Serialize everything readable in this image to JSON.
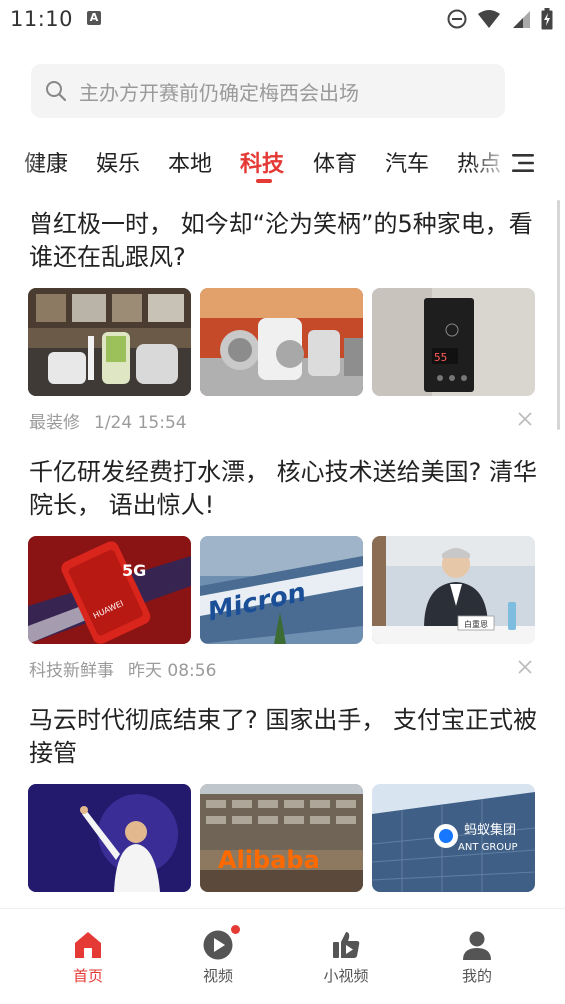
{
  "status_bar": {
    "time": "11:10",
    "notification_letter": "A"
  },
  "search": {
    "placeholder": "主办方开赛前仍确定梅西会出场"
  },
  "tabs": [
    {
      "label": "健康",
      "active": false
    },
    {
      "label": "娱乐",
      "active": false
    },
    {
      "label": "本地",
      "active": false
    },
    {
      "label": "科技",
      "active": true
    },
    {
      "label": "体育",
      "active": false
    },
    {
      "label": "汽车",
      "active": false
    },
    {
      "label": "热点",
      "active": false
    }
  ],
  "articles": [
    {
      "title": "曾红极一时， 如今却“沦为笑柄”的5种家电，看谁还在乱跟风?",
      "source": "最装修",
      "time": "1/24 15:54",
      "image_brand_text": ""
    },
    {
      "title": "千亿研发经费打水漂， 核心技术送给美国? 清华院长， 语出惊人!",
      "source": "科技新鲜事",
      "time": "昨天 08:56",
      "image_brand_text": "Micron",
      "image_badge_text": "5G",
      "image_phone_text": "HUAWEI",
      "image_nameplate_text": "白重恩"
    },
    {
      "title": "马云时代彻底结束了? 国家出手， 支付宝正式被接管",
      "source": "",
      "time": "",
      "image_brand_text": "Alibaba",
      "image_sign_cn": "蚂蚁集团",
      "image_sign_en": "ANT GROUP"
    }
  ],
  "bottom_nav": [
    {
      "label": "首页",
      "icon": "home-icon",
      "active": true
    },
    {
      "label": "视频",
      "icon": "video-play-icon",
      "active": false,
      "badge": true
    },
    {
      "label": "小视频",
      "icon": "thumbs-up-video-icon",
      "active": false
    },
    {
      "label": "我的",
      "icon": "user-icon",
      "active": false
    }
  ],
  "colors": {
    "accent": "#e53935",
    "text": "#222222",
    "meta": "#9b9b9b",
    "search_bg": "#f4f4f4"
  }
}
